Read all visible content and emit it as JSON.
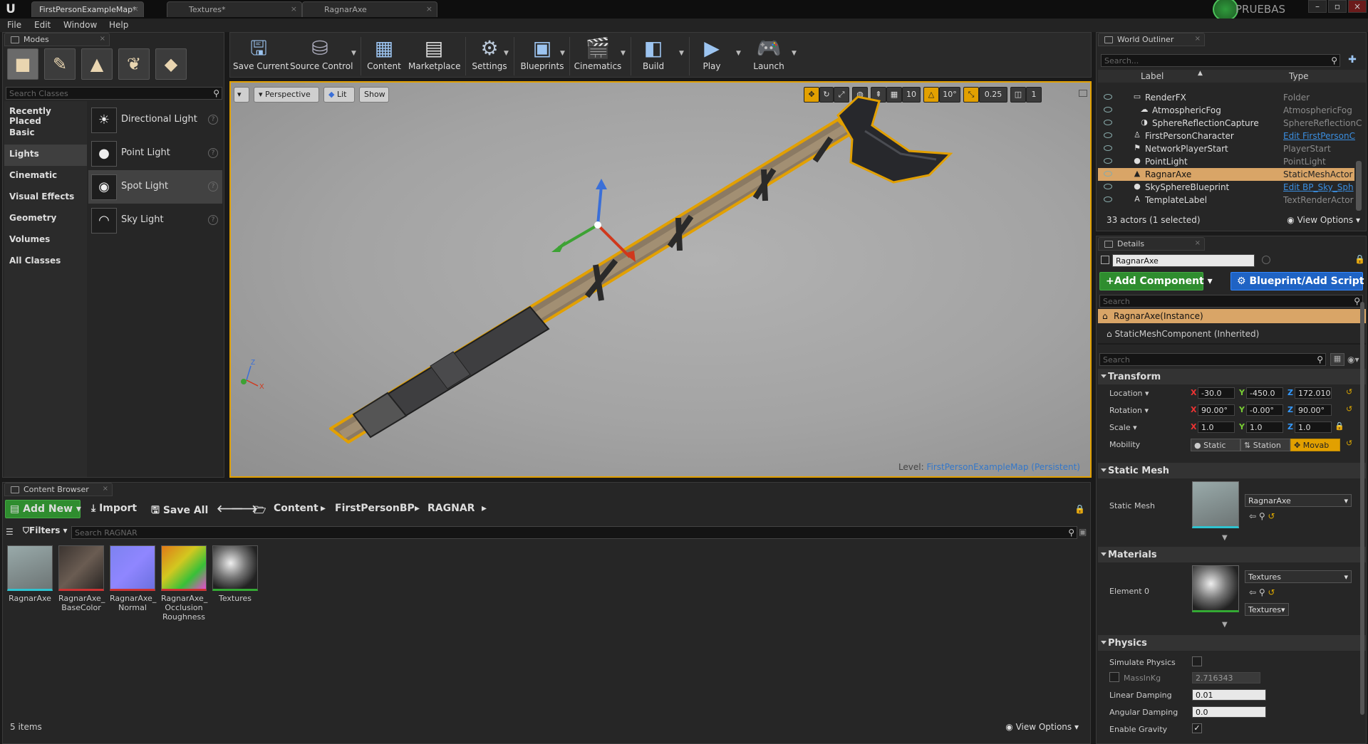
{
  "tabs": [
    {
      "label": "FirstPersonExampleMap*"
    },
    {
      "label": "Textures*"
    },
    {
      "label": "RagnarAxe"
    }
  ],
  "project_name": "PRUEBAS",
  "menu": [
    "File",
    "Edit",
    "Window",
    "Help"
  ],
  "modes": {
    "tab_label": "Modes",
    "search_placeholder": "Search Classes",
    "categories": [
      "Recently Placed",
      "Basic",
      "Lights",
      "Cinematic",
      "Visual Effects",
      "Geometry",
      "Volumes",
      "All Classes"
    ],
    "selected_category": "Lights",
    "items": [
      "Directional Light",
      "Point Light",
      "Spot Light",
      "Sky Light"
    ]
  },
  "toolbar": {
    "buttons": [
      "Save Current",
      "Source Control",
      "Content",
      "Marketplace",
      "Settings",
      "Blueprints",
      "Cinematics",
      "Build",
      "Play",
      "Launch"
    ]
  },
  "viewport": {
    "perspective": "Perspective",
    "lit": "Lit",
    "show": "Show",
    "grid_snap": "10",
    "rot_snap": "10°",
    "scale_snap": "0.25",
    "cam_speed": "1",
    "level_label": "Level:",
    "level_name": "FirstPersonExampleMap (Persistent)"
  },
  "outliner": {
    "tab_label": "World Outliner",
    "search_placeholder": "Search...",
    "col_label": "Label",
    "col_type": "Type",
    "rows": [
      {
        "name": "RenderFX",
        "type": "Folder"
      },
      {
        "name": "AtmosphericFog",
        "type": "AtmosphericFog"
      },
      {
        "name": "SphereReflectionCapture",
        "type": "SphereReflectionC"
      },
      {
        "name": "FirstPersonCharacter",
        "type": "Edit FirstPersonC"
      },
      {
        "name": "NetworkPlayerStart",
        "type": "PlayerStart"
      },
      {
        "name": "PointLight",
        "type": "PointLight"
      },
      {
        "name": "RagnarAxe",
        "type": "StaticMeshActor"
      },
      {
        "name": "SkySphereBlueprint",
        "type": "Edit BP_Sky_Sph"
      },
      {
        "name": "TemplateLabel",
        "type": "TextRenderActor"
      }
    ],
    "status": "33 actors (1 selected)",
    "view_options": "View Options"
  },
  "details": {
    "tab_label": "Details",
    "actor_name": "RagnarAxe",
    "add_component": "Add Component",
    "blueprint_script": "Blueprint/Add Script",
    "search_placeholder": "Search",
    "instance": "RagnarAxe(Instance)",
    "component": "StaticMeshComponent (Inherited)",
    "transform": {
      "section": "Transform",
      "location_label": "Location",
      "rotation_label": "Rotation",
      "scale_label": "Scale",
      "mobility_label": "Mobility",
      "location": [
        "-30.0",
        "-450.0",
        "172.010"
      ],
      "rotation": [
        "90.00°",
        "-0.00°",
        "90.00°"
      ],
      "scale": [
        "1.0",
        "1.0",
        "1.0"
      ],
      "mobility_options": [
        "Static",
        "Station",
        "Movab"
      ]
    },
    "static_mesh": {
      "section": "Static Mesh",
      "label": "Static Mesh",
      "value": "RagnarAxe"
    },
    "materials": {
      "section": "Materials",
      "element_label": "Element 0",
      "value": "Textures",
      "sub_value": "Textures"
    },
    "physics": {
      "section": "Physics",
      "simulate_label": "Simulate Physics",
      "mass_label": "MassInKg",
      "mass_value": "2.716343",
      "linear_label": "Linear Damping",
      "linear_value": "0.01",
      "angular_label": "Angular Damping",
      "angular_value": "0.0",
      "gravity_label": "Enable Gravity"
    }
  },
  "content_browser": {
    "tab_label": "Content Browser",
    "add_new": "Add New",
    "import": "Import",
    "save_all": "Save All",
    "path": [
      "Content",
      "FirstPersonBP",
      "RAGNAR"
    ],
    "filters": "Filters",
    "search_placeholder": "Search RAGNAR",
    "assets": [
      {
        "line1": "RagnarAxe",
        "line2": "",
        "line3": "",
        "color": "#2fc3d0"
      },
      {
        "line1": "RagnarAxe_",
        "line2": "BaseColor",
        "line3": "",
        "color": "#c33"
      },
      {
        "line1": "RagnarAxe_",
        "line2": "Normal",
        "line3": "",
        "color": "#c33"
      },
      {
        "line1": "RagnarAxe_",
        "line2": "Occlusion",
        "line3": "Roughness",
        "color": "#c33"
      },
      {
        "line1": "Textures",
        "line2": "",
        "line3": "",
        "color": "#3a3"
      }
    ],
    "item_count": "5 items",
    "view_options": "View Options"
  },
  "colors": {
    "accent_orange": "#e2a000",
    "selection": "#d9a567",
    "link_blue": "#3a8ee0"
  }
}
